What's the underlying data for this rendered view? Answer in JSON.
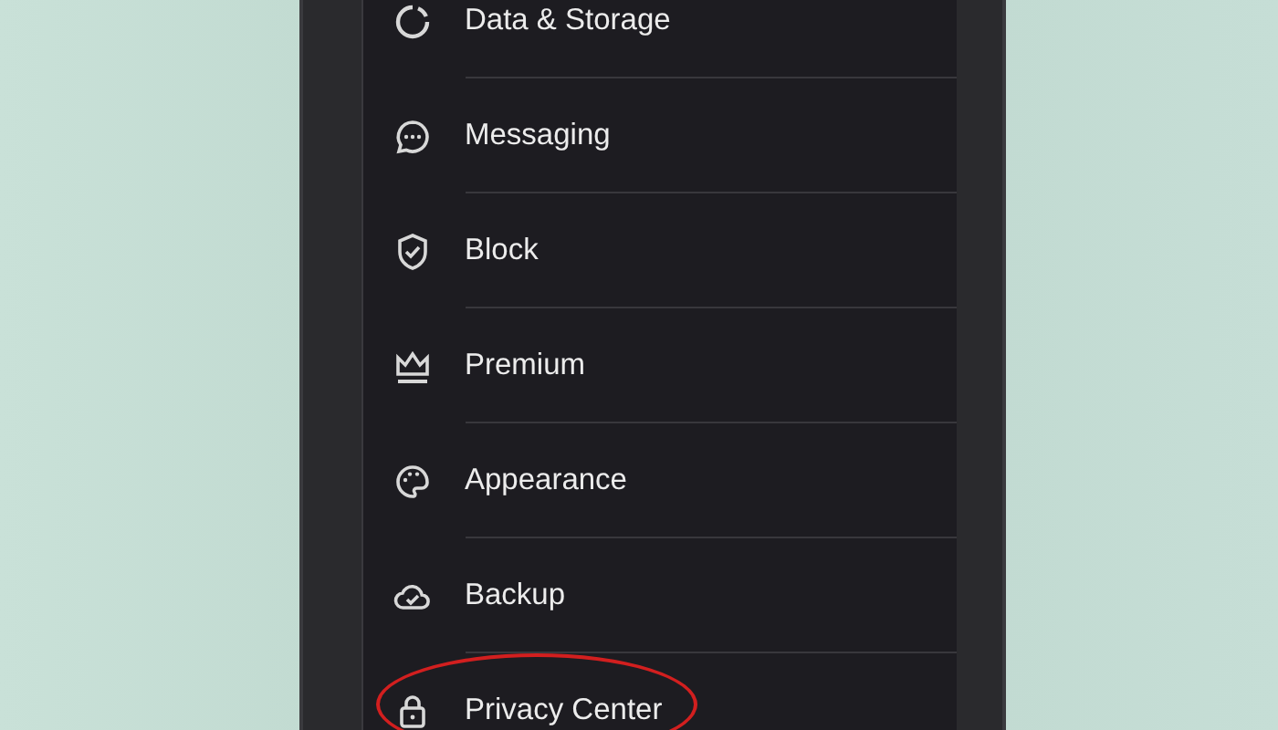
{
  "settings_items": [
    {
      "label": "Data & Storage",
      "kind": "storage",
      "highlighted": false
    },
    {
      "label": "Messaging",
      "kind": "chat",
      "highlighted": false
    },
    {
      "label": "Block",
      "kind": "shield",
      "highlighted": false
    },
    {
      "label": "Premium",
      "kind": "crown",
      "highlighted": false
    },
    {
      "label": "Appearance",
      "kind": "palette",
      "highlighted": false
    },
    {
      "label": "Backup",
      "kind": "cloud",
      "highlighted": false
    },
    {
      "label": "Privacy Center",
      "kind": "lock",
      "highlighted": true
    }
  ]
}
